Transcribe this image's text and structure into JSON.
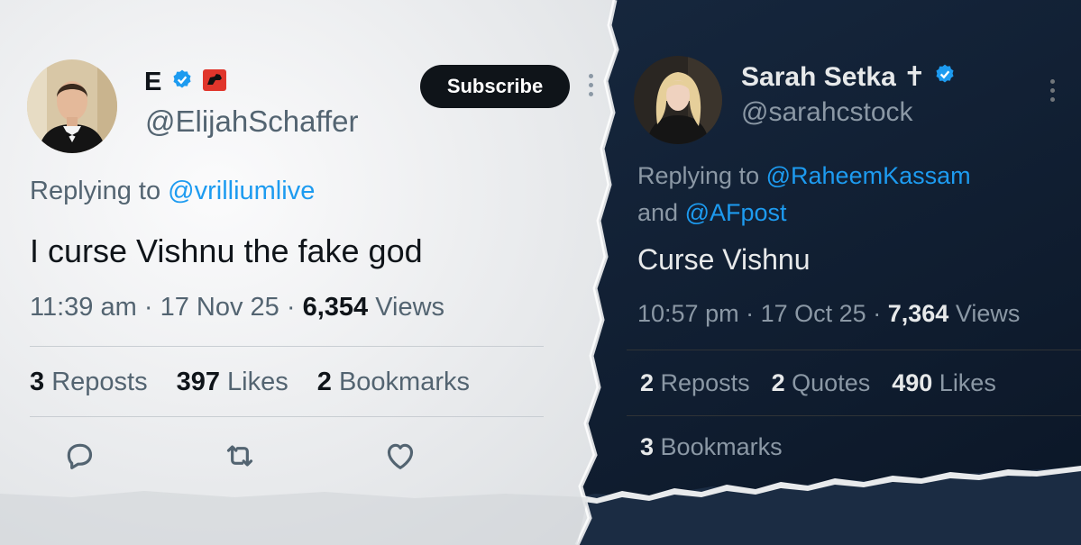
{
  "left_tweet": {
    "display_name": "E",
    "handle": "@ElijahSchaffer",
    "subscribe_label": "Subscribe",
    "reply_prefix": "Replying to",
    "reply_to": "@vrilliumlive",
    "text": "I curse Vishnu the fake god",
    "time": "11:39 am",
    "date": "17 Nov 25",
    "views_count": "6,354",
    "views_label": "Views",
    "separator": "·",
    "stats": [
      {
        "count": "3",
        "label": "Reposts"
      },
      {
        "count": "397",
        "label": "Likes"
      },
      {
        "count": "2",
        "label": "Bookmarks"
      }
    ],
    "icons": [
      "verified-badge-icon",
      "affiliate-badge-icon",
      "reply-icon",
      "repost-icon",
      "like-icon",
      "more-icon"
    ]
  },
  "right_tweet": {
    "display_name": "Sarah Setka",
    "name_glyph": "✝",
    "handle": "@sarahcstock",
    "reply_prefix": "Replying to",
    "reply_to": "@RaheemKassam",
    "reply_and": "and",
    "reply_to_2": "@AFpost",
    "text": "Curse Vishnu",
    "time": "10:57 pm",
    "date": "17 Oct 25",
    "views_count": "7,364",
    "views_label": "Views",
    "separator": "·",
    "stats": [
      {
        "count": "2",
        "label": "Reposts"
      },
      {
        "count": "2",
        "label": "Quotes"
      },
      {
        "count": "490",
        "label": "Likes"
      }
    ],
    "stats_row2": [
      {
        "count": "3",
        "label": "Bookmarks"
      }
    ],
    "icons": [
      "verified-badge-icon",
      "more-icon"
    ]
  },
  "colors": {
    "light_bg": "#f3f4f5",
    "dark_bg": "#15263c",
    "link_blue": "#1d9bf0",
    "verified_blue": "#1d9bf0"
  }
}
